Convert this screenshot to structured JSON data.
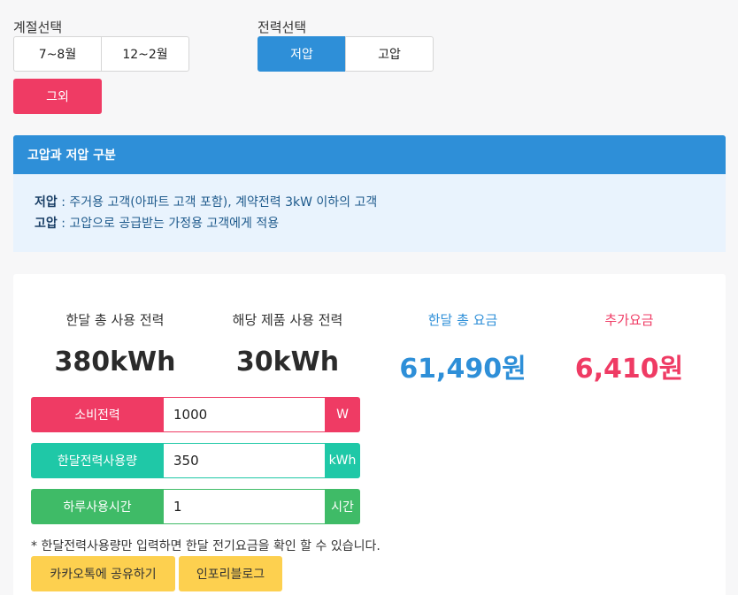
{
  "season": {
    "label": "계절선택",
    "options": [
      "7~8월",
      "12~2월"
    ],
    "other_label": "그외"
  },
  "power": {
    "label": "전력선택",
    "options": [
      "저압",
      "고압"
    ],
    "selected": "저압"
  },
  "info": {
    "title": "고압과 저압 구분",
    "low_term": "저압",
    "low_desc": " : 주거용 고객(아파트 고객 포함), 계약전력 3kW 이하의 고객",
    "high_term": "고압",
    "high_desc": " : 고압으로 공급받는 가정용 고객에게 적용"
  },
  "stats": [
    {
      "label": "한달 총 사용 전력",
      "value": "380kWh"
    },
    {
      "label": "해당 제품 사용 전력",
      "value": "30kWh"
    },
    {
      "label": "한달 총 요금",
      "value": "61,490원"
    },
    {
      "label": "추가요금",
      "value": "6,410원"
    }
  ],
  "inputs": {
    "consumption": {
      "label": "소비전력",
      "value": "1000",
      "unit": "W"
    },
    "monthly_usage": {
      "label": "한달전력사용량",
      "value": "350",
      "unit": "kWh"
    },
    "daily_hours": {
      "label": "하루사용시간",
      "value": "1",
      "unit": "시간"
    }
  },
  "note": "* 한달전력사용량만 입력하면 한달 전기요금을 확인 할 수 있습니다.",
  "buttons": {
    "kakao": "카카오톡에 공유하기",
    "blog": "인포리블로그"
  },
  "colors": {
    "blue": "#2e8fd8",
    "pink": "#ef3b64",
    "teal": "#1fc8a7",
    "green": "#3fbb67",
    "yellow": "#fdd04f"
  }
}
